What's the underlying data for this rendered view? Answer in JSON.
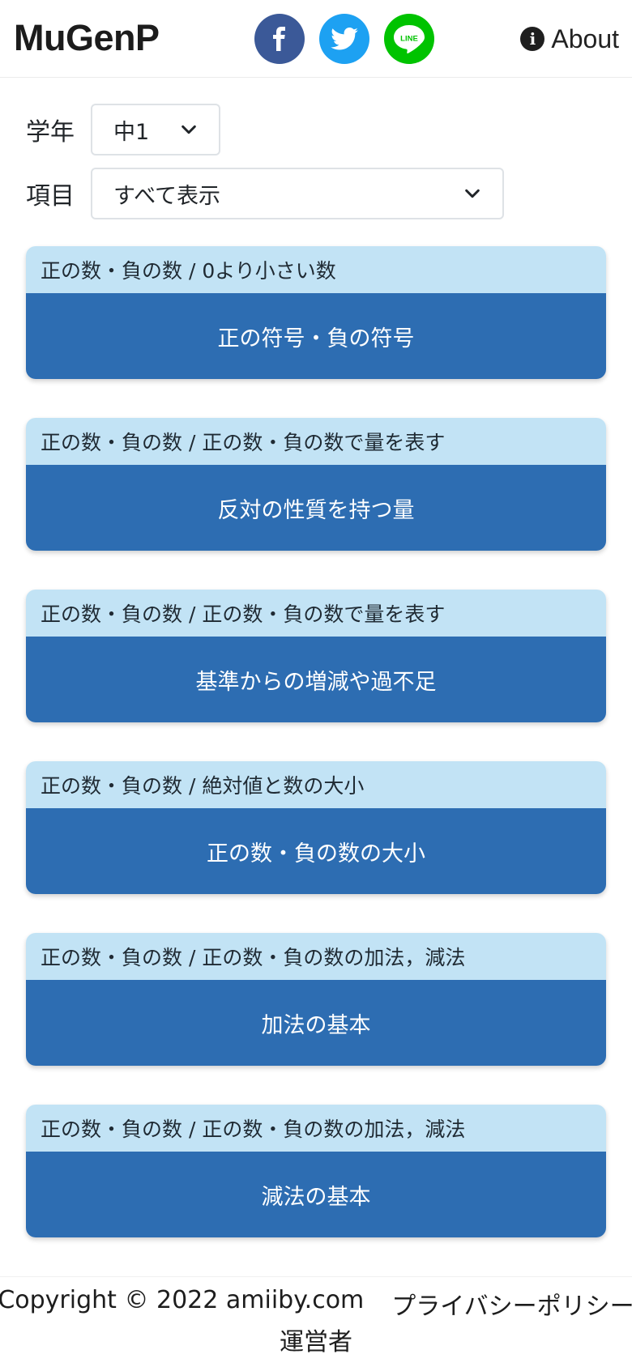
{
  "header": {
    "brand": "MuGenP",
    "about_label": "About",
    "about_icon": "info-icon",
    "social": [
      {
        "name": "facebook",
        "color": "#3b5998"
      },
      {
        "name": "twitter",
        "color": "#1da1f2"
      },
      {
        "name": "line",
        "color": "#00c300",
        "text": "LINE"
      }
    ]
  },
  "filters": {
    "grade": {
      "label": "学年",
      "value": "中1"
    },
    "item": {
      "label": "項目",
      "value": "すべて表示"
    }
  },
  "cards": [
    {
      "category": "正の数・負の数 / 0より小さい数",
      "title": "正の符号・負の符号"
    },
    {
      "category": "正の数・負の数 / 正の数・負の数で量を表す",
      "title": "反対の性質を持つ量"
    },
    {
      "category": "正の数・負の数 / 正の数・負の数で量を表す",
      "title": "基準からの増減や過不足"
    },
    {
      "category": "正の数・負の数 / 絶対値と数の大小",
      "title": "正の数・負の数の大小"
    },
    {
      "category": "正の数・負の数 / 正の数・負の数の加法，減法",
      "title": "加法の基本"
    },
    {
      "category": "正の数・負の数 / 正の数・負の数の加法，減法",
      "title": "減法の基本"
    }
  ],
  "footer": {
    "copyright": "Copyright © 2022 amiiby.com",
    "privacy": "プライバシーポリシー",
    "operator": "運営者"
  },
  "colors": {
    "card_header": "#c2e3f5",
    "card_body": "#2d6db2"
  }
}
